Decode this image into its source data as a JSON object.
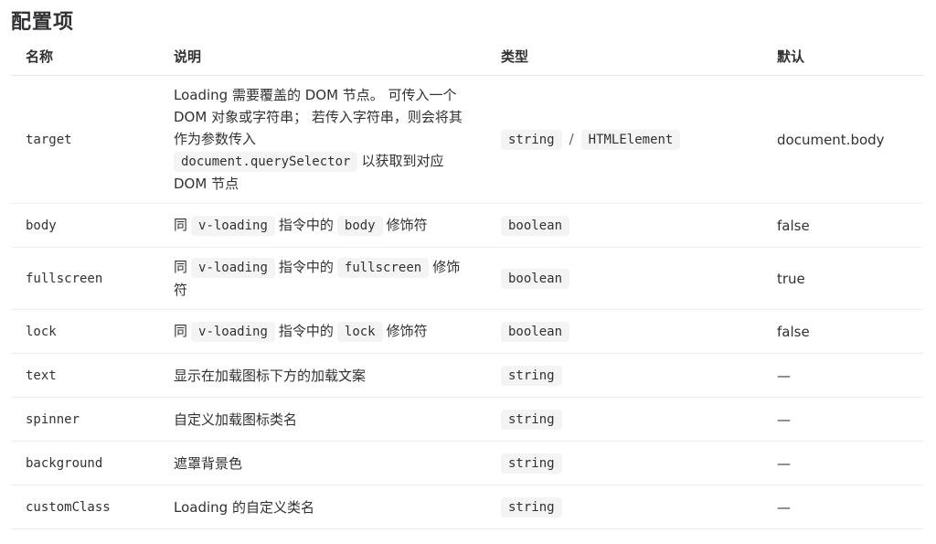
{
  "title": "配置项",
  "headers": {
    "name": "名称",
    "desc": "说明",
    "type": "类型",
    "default": "默认"
  },
  "rows": [
    {
      "name": "target",
      "desc_1": "Loading 需要覆盖的 DOM 节点。 可传入一个 DOM 对象或字符串； 若传入字符串，则会将其作为参数传入",
      "desc_code": "document.querySelector",
      "desc_2": "以获取到对应 DOM 节点",
      "type_1": "string",
      "type_sep": "/",
      "type_2": "HTMLElement",
      "default": "document.body"
    },
    {
      "name": "body",
      "desc_pre": "同",
      "desc_code1": "v-loading",
      "desc_mid": "指令中的",
      "desc_code2": "body",
      "desc_post": "修饰符",
      "type": "boolean",
      "default": "false"
    },
    {
      "name": "fullscreen",
      "desc_pre": "同",
      "desc_code1": "v-loading",
      "desc_mid": "指令中的",
      "desc_code2": "fullscreen",
      "desc_post": "修饰符",
      "type": "boolean",
      "default": "true"
    },
    {
      "name": "lock",
      "desc_pre": "同",
      "desc_code1": "v-loading",
      "desc_mid": "指令中的",
      "desc_code2": "lock",
      "desc_post": "修饰符",
      "type": "boolean",
      "default": "false"
    },
    {
      "name": "text",
      "desc": "显示在加载图标下方的加载文案",
      "type": "string",
      "default": "—"
    },
    {
      "name": "spinner",
      "desc": "自定义加载图标类名",
      "type": "string",
      "default": "—"
    },
    {
      "name": "background",
      "desc": "遮罩背景色",
      "type": "string",
      "default": "—"
    },
    {
      "name": "customClass",
      "desc": "Loading 的自定义类名",
      "type": "string",
      "default": "—"
    }
  ]
}
